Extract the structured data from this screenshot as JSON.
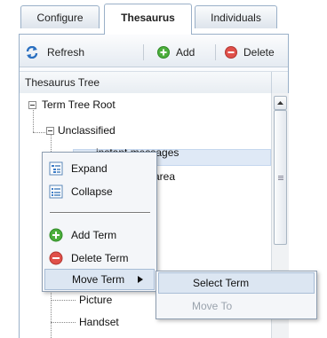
{
  "tabs": [
    {
      "label": "Configure",
      "active": false
    },
    {
      "label": "Thesaurus",
      "active": true
    },
    {
      "label": "Individuals",
      "active": false
    }
  ],
  "toolbar": {
    "refresh_label": "Refresh",
    "add_label": "Add",
    "delete_label": "Delete",
    "refresh_icon": "refresh-icon",
    "add_icon": "add-icon",
    "delete_icon": "delete-icon"
  },
  "tree": {
    "header": "Thesaurus Tree",
    "nodes": {
      "root": "Term Tree Root",
      "unclassified": "Unclassified",
      "instant": "instant messages",
      "area": "area",
      "picture": "Picture",
      "handset": "Handset"
    }
  },
  "context_menu": {
    "expand": "Expand",
    "collapse": "Collapse",
    "add_term": "Add Term",
    "delete_term": "Delete Term",
    "move_term": "Move Term"
  },
  "submenu": {
    "select_term": "Select Term",
    "move_to": "Move To"
  },
  "colors": {
    "add": "#4cae3c",
    "delete": "#e0504a",
    "refresh": "#2a6fc0",
    "selection": "#dfe9f6"
  }
}
